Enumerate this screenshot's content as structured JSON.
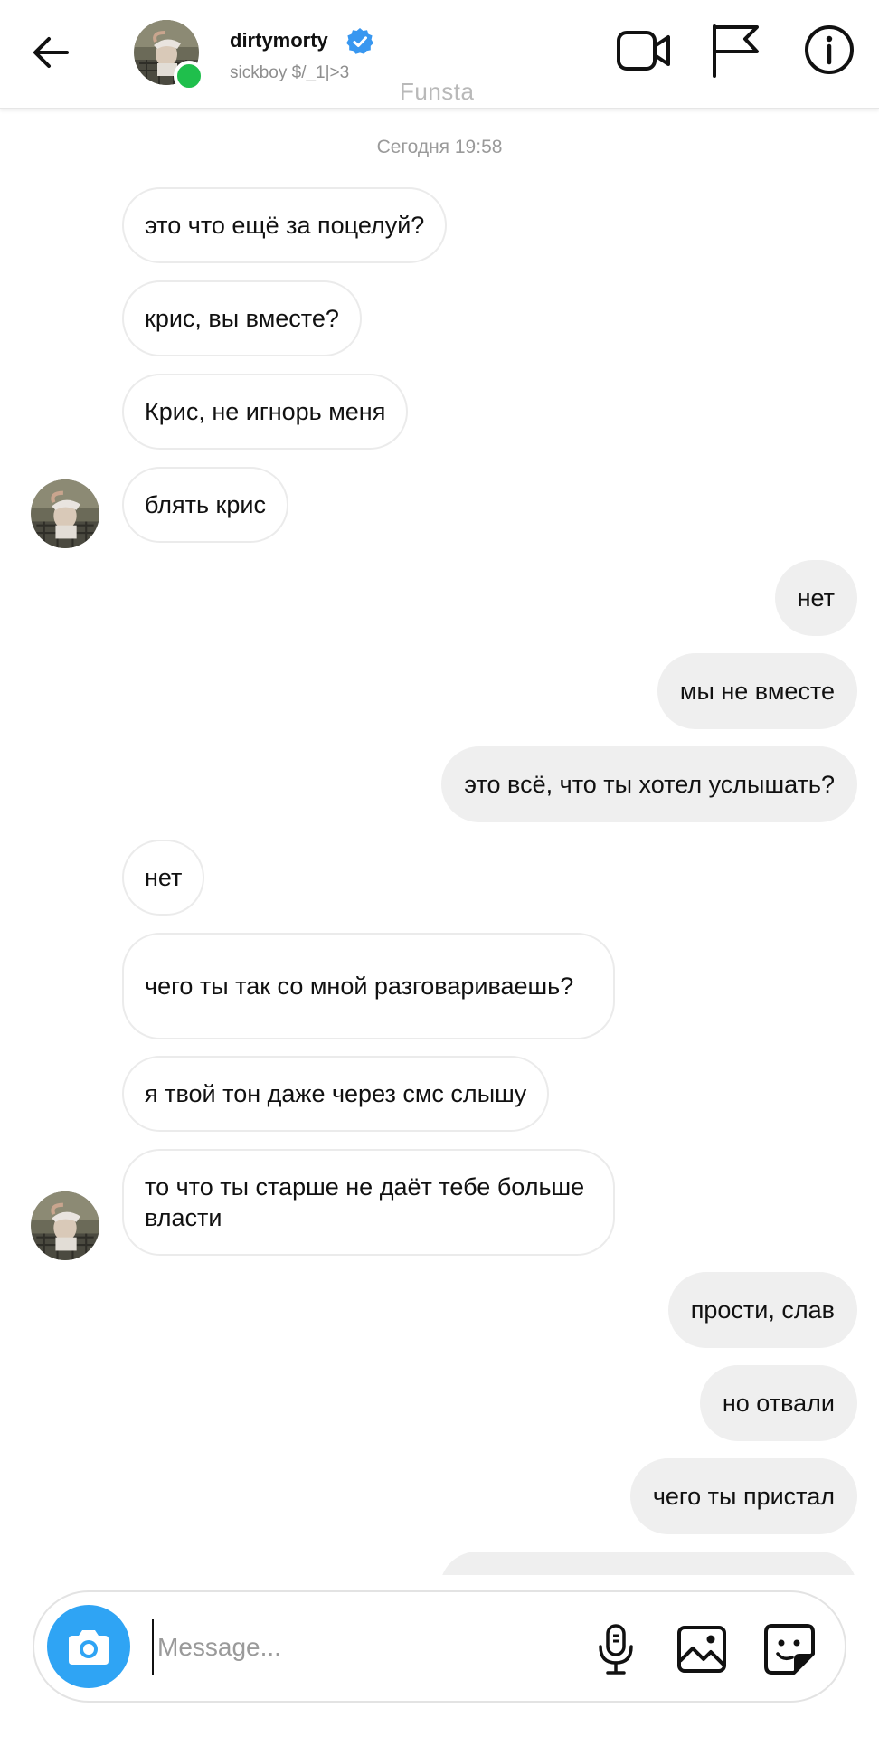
{
  "header": {
    "username": "dirtymorty",
    "subtitle": "sickboy $/_1|>3",
    "watermark": "Funsta",
    "icons": {
      "back": "arrow-left-icon",
      "verified": "verified-badge-icon",
      "video": "video-camera-icon",
      "flag": "flag-icon",
      "info": "info-icon"
    },
    "status": "online"
  },
  "chat": {
    "timestamp": "Сегодня 19:58",
    "messages": [
      {
        "side": "in",
        "text": "это что ещё за поцелуй?"
      },
      {
        "side": "in",
        "text": "крис, вы вместе?"
      },
      {
        "side": "in",
        "text": "Крис, не игнорь меня"
      },
      {
        "side": "in",
        "text": "блять крис"
      },
      {
        "side": "out",
        "text": "нет"
      },
      {
        "side": "out",
        "text": "мы не вместе"
      },
      {
        "side": "out",
        "text": "это всё, что ты хотел услышать?"
      },
      {
        "side": "in",
        "text": "нет"
      },
      {
        "side": "in",
        "text": "чего ты так со мной разговариваешь?"
      },
      {
        "side": "in",
        "text": "я твой тон даже через смс слышу"
      },
      {
        "side": "in",
        "text": "то что ты старше не даёт тебе больше власти"
      },
      {
        "side": "out",
        "text": "прости, слав"
      },
      {
        "side": "out",
        "text": "но отвали"
      },
      {
        "side": "out",
        "text": "чего ты пристал"
      },
      {
        "side": "out",
        "text": ""
      }
    ]
  },
  "composer": {
    "placeholder": "Message...",
    "value": "",
    "icons": {
      "camera": "camera-icon",
      "mic": "microphone-icon",
      "gallery": "gallery-icon",
      "sticker": "sticker-icon"
    }
  },
  "colors": {
    "accent_blue": "#2fa4f4",
    "verified_blue": "#3897f0",
    "online_green": "#1fbf4c",
    "outgoing_bubble": "#efefef",
    "incoming_border": "#ebebeb"
  }
}
